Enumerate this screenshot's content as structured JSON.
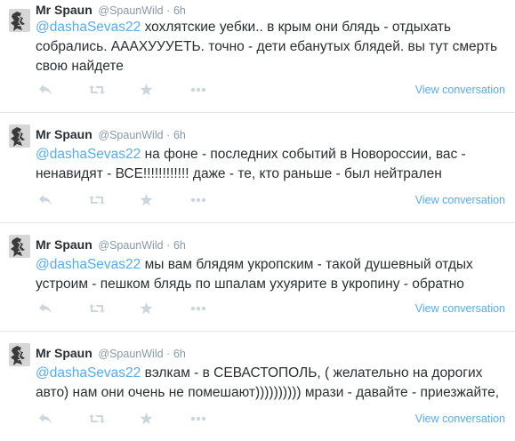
{
  "tweets": [
    {
      "name": "Mr Spaun",
      "handle": "@SpaunWild",
      "separator": "·",
      "time": "6h",
      "mention": "@dashaSevas22",
      "body": " хохлятские уебки.. в крым они блядь - отдыхать собрались. АААХУУУЕТЬ. точно - дети ебанутых блядей. вы тут смерть свою найдете",
      "view_conversation": "View conversation"
    },
    {
      "name": "Mr Spaun",
      "handle": "@SpaunWild",
      "separator": "·",
      "time": "6h",
      "mention": "@dashaSevas22",
      "body": " на фоне - последних событий в Новороссии, вас - ненавидят - ВСЕ!!!!!!!!!!!! даже - те, кто раньше - был нейтрален",
      "view_conversation": "View conversation"
    },
    {
      "name": "Mr Spaun",
      "handle": "@SpaunWild",
      "separator": "·",
      "time": "6h",
      "mention": "@dashaSevas22",
      "body": " мы вам блядям укропским - такой душевный отдых устроим - пешком блядь по шпалам ухуярите в укропину - обратно",
      "view_conversation": "View conversation"
    },
    {
      "name": "Mr Spaun",
      "handle": "@SpaunWild",
      "separator": "·",
      "time": "6h",
      "mention": "@dashaSevas22",
      "body": " вэлкам - в СЕВАСТОПОЛЬ, ( желательно на дорогих авто) нам они очень не помешают)))))))))) мрази - давайте - приезжайте,",
      "view_conversation": "View conversation"
    }
  ],
  "icons": [
    "reply-icon",
    "retweet-icon",
    "favorite-icon",
    "more-icon"
  ],
  "colors": {
    "link": "#55acee",
    "muted": "#8899a6",
    "text": "#292f33",
    "action_icon": "#ccd6dd",
    "divider": "#e1e8ed"
  }
}
